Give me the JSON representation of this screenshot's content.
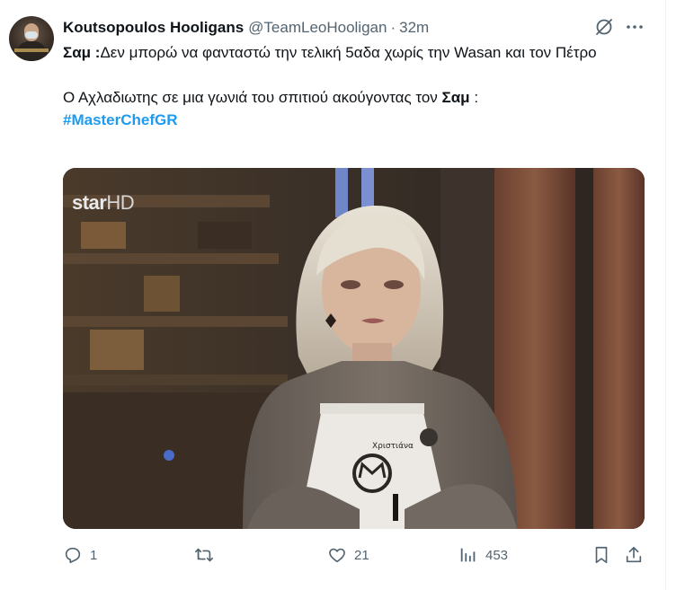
{
  "tweet": {
    "author_name": "Koutsopoulos Hooligans",
    "handle": "@TeamLeoHooligan",
    "separator": "·",
    "time": "32m",
    "line1_bold": "Σαμ :",
    "line1_text": "Δεν μπορώ να φανταστώ την τελική 5αδα χωρίς την Wasan και τον Πέτρο",
    "line2_text": "Ο Αχλαδιωτης σε μια γωνιά του σπιτιού ακούγοντας τον ",
    "line2_bold": "Σαμ",
    "line2_end": " :",
    "hashtag": "#MasterChefGR"
  },
  "media": {
    "watermark_star": "star",
    "watermark_hd": "HD",
    "apron_name": "Χριστιάνα"
  },
  "actions": {
    "replies": "1",
    "reposts": "",
    "likes": "21",
    "views": "453"
  },
  "colors": {
    "link": "#1d9bf0",
    "muted": "#536471",
    "text": "#0f1419"
  },
  "icons": [
    "grok-icon",
    "more-icon",
    "reply-icon",
    "repost-icon",
    "like-icon",
    "views-icon",
    "bookmark-icon",
    "share-icon"
  ]
}
